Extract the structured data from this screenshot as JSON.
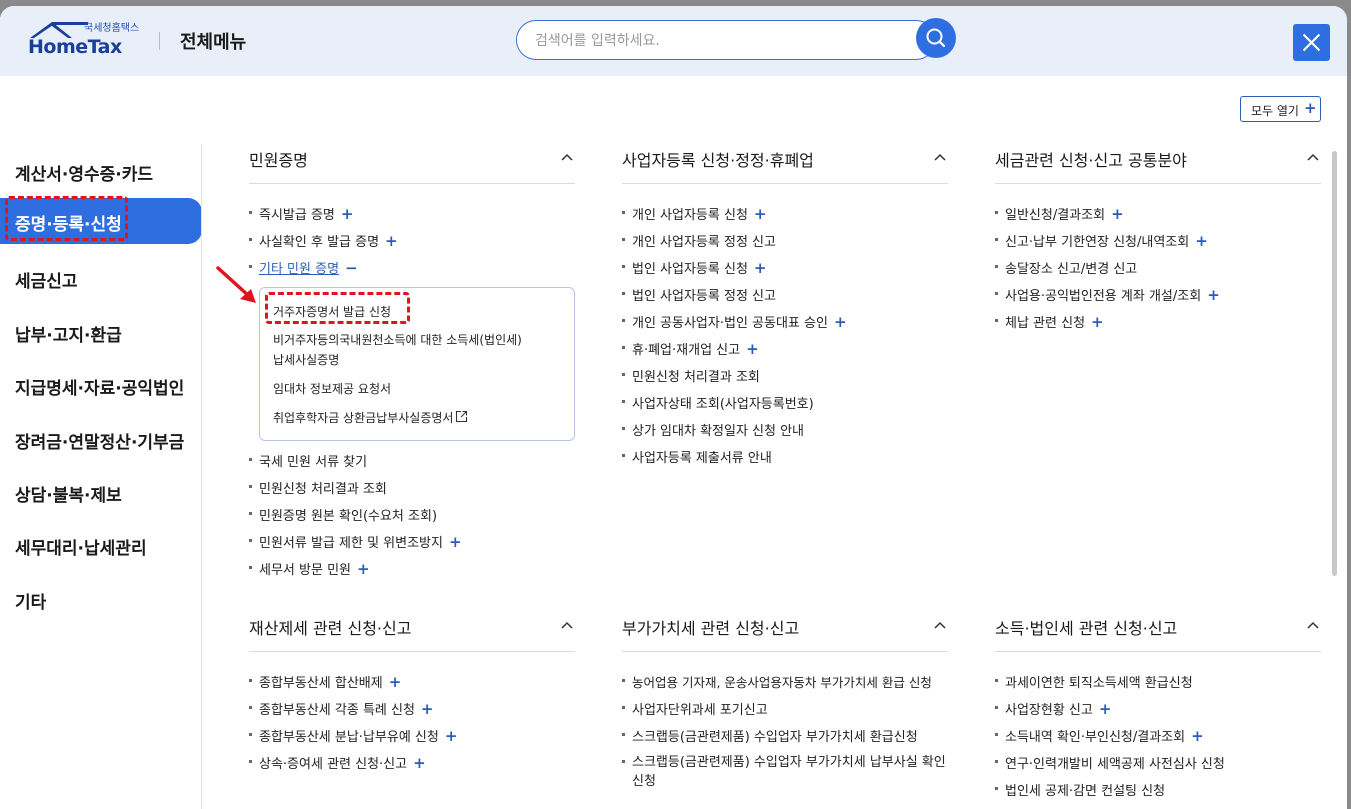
{
  "header": {
    "logo_sub": "국세청홈택스",
    "logo_main": "HomeTax",
    "title": "전체메뉴",
    "search_placeholder": "검색어를 입력하세요."
  },
  "open_all_label": "모두 열기",
  "sidebar": {
    "items": [
      {
        "label": "계산서·영수증·카드"
      },
      {
        "label": "증명·등록·신청",
        "active": true
      },
      {
        "label": "세금신고"
      },
      {
        "label": "납부·고지·환급"
      },
      {
        "label": "지급명세·자료·공익법인"
      },
      {
        "label": "장려금·연말정산·기부금"
      },
      {
        "label": "상담·불복·제보"
      },
      {
        "label": "세무대리·납세관리"
      },
      {
        "label": "기타"
      }
    ]
  },
  "sections": {
    "civil": {
      "title": "민원증명",
      "items_top": [
        {
          "label": "즉시발급 증명",
          "plus": true
        },
        {
          "label": "사실확인 후 발급 증명",
          "plus": true
        },
        {
          "label": "기타 민원 증명",
          "expanded": true
        }
      ],
      "sub_items": [
        "거주자증명서 발급 신청",
        "비거주자등의국내원천소득에 대한 소득세(법인세)",
        "납세사실증명",
        "임대차 정보제공 요청서",
        "취업후학자금 상환금납부사실증명서"
      ],
      "items_bottom": [
        {
          "label": "국세 민원 서류 찾기"
        },
        {
          "label": "민원신청 처리결과 조회"
        },
        {
          "label": "민원증명 원본 확인(수요처 조회)"
        },
        {
          "label": "민원서류 발급 제한 및 위변조방지",
          "plus": true
        },
        {
          "label": "세무서 방문 민원",
          "plus": true
        }
      ]
    },
    "biz_reg": {
      "title": "사업자등록 신청·정정·휴폐업",
      "items": [
        {
          "label": "개인 사업자등록 신청",
          "plus": true
        },
        {
          "label": "개인 사업자등록 정정 신고"
        },
        {
          "label": "법인 사업자등록 신청",
          "plus": true
        },
        {
          "label": "법인 사업자등록 정정 신고"
        },
        {
          "label": "개인 공동사업자·법인 공동대표 승인",
          "plus": true
        },
        {
          "label": "휴·폐업·재개업 신고",
          "plus": true
        },
        {
          "label": "민원신청 처리결과 조회"
        },
        {
          "label": "사업자상태 조회(사업자등록번호)"
        },
        {
          "label": "상가 임대차 확정일자 신청 안내"
        },
        {
          "label": "사업자등록 제출서류 안내"
        }
      ]
    },
    "common": {
      "title": "세금관련 신청·신고 공통분야",
      "items": [
        {
          "label": "일반신청/결과조회",
          "plus": true
        },
        {
          "label": "신고·납부 기한연장 신청/내역조회",
          "plus": true
        },
        {
          "label": "송달장소 신고/변경 신고"
        },
        {
          "label": "사업용·공익법인전용 계좌 개설/조회",
          "plus": true
        },
        {
          "label": "체납 관련 신청",
          "plus": true
        }
      ]
    },
    "property": {
      "title": "재산제세 관련 신청·신고",
      "items": [
        {
          "label": "종합부동산세 합산배제",
          "plus": true
        },
        {
          "label": "종합부동산세 각종 특례 신청",
          "plus": true
        },
        {
          "label": "종합부동산세 분납·납부유예 신청",
          "plus": true
        },
        {
          "label": "상속·증여세 관련 신청·신고",
          "plus": true
        }
      ]
    },
    "vat": {
      "title": "부가가치세 관련 신청·신고",
      "items": [
        {
          "label": "농어업용 기자재, 운송사업용자동차 부가가치세 환급 신청"
        },
        {
          "label": "사업자단위과세 포기신고"
        },
        {
          "label": "스크랩등(금관련제품) 수입업자 부가가치세 환급신청"
        },
        {
          "label": "스크랩등(금관련제품) 수입업자 부가가치세 납부사실 확인신청"
        }
      ]
    },
    "income": {
      "title": "소득·법인세 관련 신청·신고",
      "items": [
        {
          "label": "과세이연한 퇴직소득세액 환급신청"
        },
        {
          "label": "사업장현황 신고",
          "plus": true
        },
        {
          "label": "소득내역 확인·부인신청/결과조회",
          "plus": true
        },
        {
          "label": "연구·인력개발비 세액공제 사전심사 신청"
        },
        {
          "label": "법인세 공제·감면 컨설팅 신청"
        }
      ]
    }
  },
  "colors": {
    "accent": "#2f6ee0",
    "header_bg": "#e9eff8",
    "highlight": "#e0141e"
  }
}
